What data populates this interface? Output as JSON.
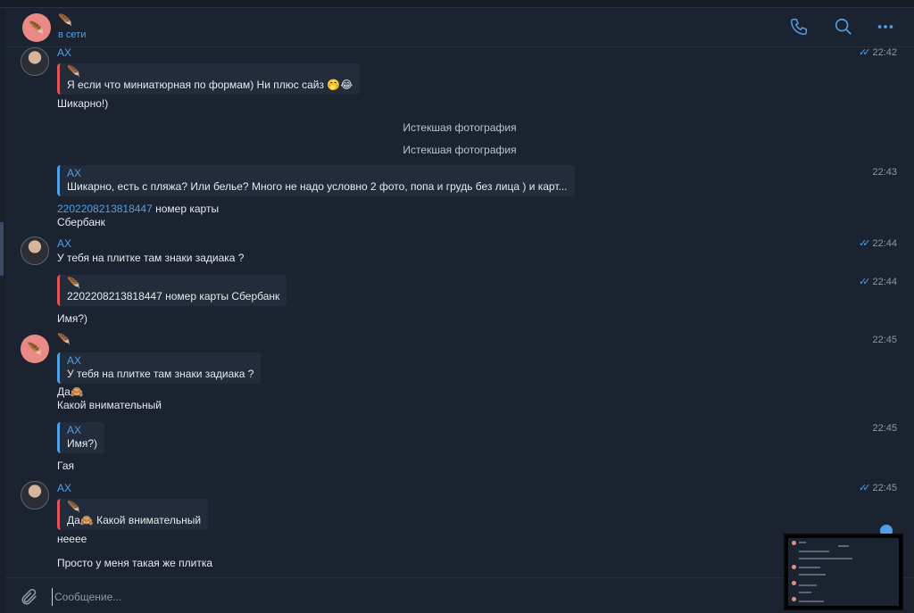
{
  "header": {
    "name": "🪶",
    "status": "в сети",
    "icons": [
      "phone-icon",
      "search-icon",
      "more-icon"
    ]
  },
  "messages": [
    {
      "sender": "AX",
      "time": "22:42",
      "read": true,
      "reply": {
        "name": "🪶",
        "text": "Я если что миниатюрная по формам)  Ни плюс сайз 🤭😂"
      },
      "text": "Шикарно!)"
    },
    {
      "service1": "Истекшая фотография",
      "service2": "Истекшая фотография"
    },
    {
      "time": "22:43",
      "reply": {
        "name": "AX",
        "text": "Шикарно, есть с пляжа? Или белье? Много не надо условно 2 фото, попа и грудь без лица ) и карт..."
      },
      "link": "2202208213818447",
      "text_after_link": " номер карты",
      "text2": "Сбербанк"
    },
    {
      "sender": "AX",
      "time": "22:44",
      "read": true,
      "text": "У тебя на плитке там знаки задиака ?"
    },
    {
      "time": "22:44",
      "read": true,
      "reply": {
        "name": "🪶",
        "text": "2202208213818447 номер карты  Сбербанк"
      },
      "text": "Имя?)"
    },
    {
      "sender": "🪶",
      "time": "22:45",
      "reply": {
        "name": "AX",
        "text": "У тебя на плитке там знаки задиака ?"
      },
      "text": "Да🙈",
      "text2": "Какой внимательный"
    },
    {
      "time": "22:45",
      "reply": {
        "name": "AX",
        "text": "Имя?)"
      },
      "text": "Гая"
    },
    {
      "sender": "AX",
      "time": "22:45",
      "read": true,
      "reply": {
        "name": "🪶",
        "text": "Да🙈  Какой внимательный"
      },
      "text": "нееее",
      "text2": "Просто у меня такая же плитка"
    }
  ],
  "composer": {
    "placeholder": "Сообщение..."
  },
  "colors": {
    "accent": "#4fa0e8",
    "background": "#1c2330",
    "bubble": "#232c3b",
    "reply_red": "#e05555"
  }
}
